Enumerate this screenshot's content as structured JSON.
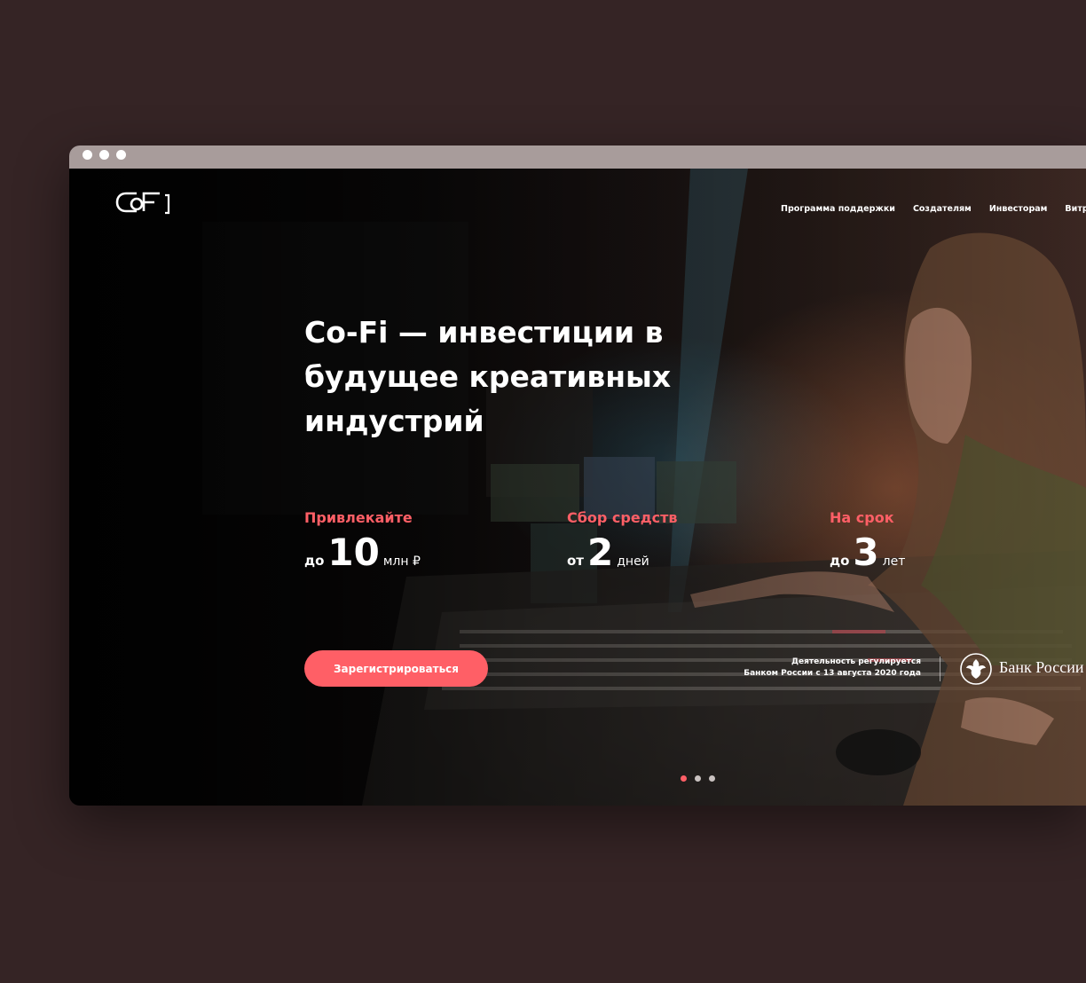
{
  "nav": {
    "items": [
      "Программа поддержки",
      "Создателям",
      "Инвесторам",
      "Витрина"
    ]
  },
  "hero": {
    "headline": "Co-Fi — инвестиции в будущее креативных индустрий",
    "stats": [
      {
        "title": "Привлекайте",
        "prefix": "до",
        "value": "10",
        "unit": "млн ₽"
      },
      {
        "title": "Сбор средств",
        "prefix": "от",
        "value": "2",
        "unit": "дней"
      },
      {
        "title": "На срок",
        "prefix": "до",
        "value": "3",
        "unit": "лет"
      }
    ],
    "register_label": "Зарегистрироваться"
  },
  "regulation": {
    "line1": "Деятельность регулируется",
    "line2": "Банком России с 13 августа 2020 года",
    "bank_name": "Банк России"
  },
  "carousel": {
    "count": 3,
    "active_index": 0
  },
  "colors": {
    "accent": "#ff5f66",
    "page_background": "#352425",
    "titlebar": "#a89c9b"
  },
  "icons": {
    "logo": "cofi-logo",
    "regulator": "bank-of-russia-emblem-icon"
  }
}
